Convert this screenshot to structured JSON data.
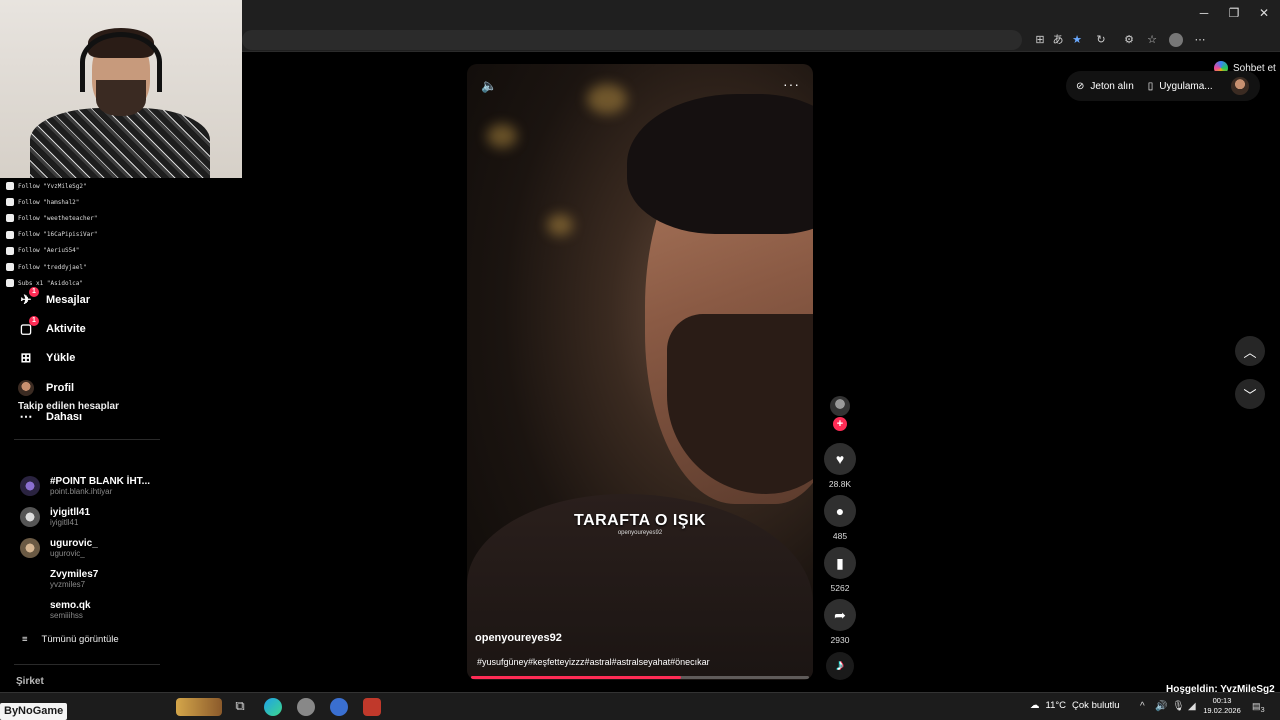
{
  "window": {
    "minimize": "─",
    "restore": "❐",
    "close": "✕"
  },
  "browser": {
    "copilot_label": "Sohbet et"
  },
  "alerts": [
    "Follow \"YvzMileSg2\"",
    "Follow \"hamshal2\"",
    "Follow \"weetheteacher\"",
    "Follow \"16CaPipisiVar\"",
    "Follow \"AeriuS54\"",
    "Follow \"treddyjael\"",
    "Subs x1 \"Asidolca\""
  ],
  "sidebar": {
    "nav": [
      {
        "label": "Mesajlar",
        "badge": "1"
      },
      {
        "label": "Aktivite",
        "badge": "1"
      },
      {
        "label": "Yükle"
      },
      {
        "label": "Profil"
      },
      {
        "label": "Dahası"
      }
    ],
    "following_title": "Takip edilen hesaplar",
    "following": [
      {
        "name": "#POINT BLANK İHT...",
        "user": "point.blank.ihtiyar"
      },
      {
        "name": "iyigitll41",
        "user": "iyigitll41"
      },
      {
        "name": "ugurovic_",
        "user": "ugurovic_"
      },
      {
        "name": "Zvymiles7",
        "user": "yvzmiles7"
      },
      {
        "name": "semo.qk",
        "user": "semiiihss"
      }
    ],
    "show_all": "Tümünü görüntüle",
    "company": "Şirket"
  },
  "video": {
    "caption": "TARAFTA O IŞIK",
    "caption_sub": "openyoureyes92",
    "username": "openyoureyes92",
    "hashtags": "#yusufgüney#keşfetteyizzz#astral#astralseyahat#önecıkar",
    "progress": 0.62,
    "more_icon": "···"
  },
  "actions": {
    "likes": "28.8K",
    "comments": "485",
    "saves": "5262",
    "shares": "2930"
  },
  "topright": {
    "coins": "Jeton alın",
    "app": "Uygulama..."
  },
  "taskbar": {
    "brand": "ByNoGame",
    "welcome": "Hoşgeldin: YvzMileSg2",
    "temp": "11°C",
    "weather": "Çok bulutlu",
    "time": "00:13",
    "date": "19.02.2026",
    "notifications": "3"
  },
  "colors": {
    "accent": "#fe2c55",
    "background": "#000000",
    "chrome": "#1f1f1f"
  }
}
